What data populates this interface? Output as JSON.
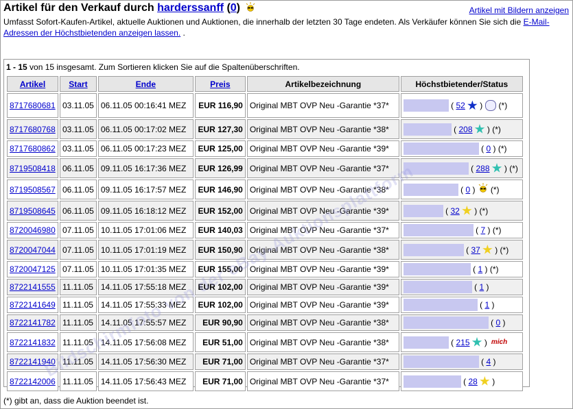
{
  "header": {
    "title_prefix": "Artikel für den Verkauf durch",
    "seller": "harderssanff",
    "feedback_open": "(",
    "feedback_score": "0",
    "feedback_close": ")",
    "new_member_icon": "sunglasses-icon",
    "pictures_link": "Artikel mit Bildern anzeigen"
  },
  "description": {
    "text": "Umfasst Sofort-Kaufen-Artikel, aktuelle Auktionen und Auktionen, die innerhalb der letzten 30 Tage endeten. Als Verkäufer können Sie sich die",
    "link": "E-Mail-Adressen der Höchstbietenden anzeigen lassen.",
    "suffix": "."
  },
  "summary": {
    "range": "1 - 15",
    "text": "von 15 insgesamt. Zum Sortieren klicken Sie auf die Spaltenüberschriften."
  },
  "columns": {
    "artikel": "Artikel",
    "start": "Start",
    "ende": "Ende",
    "preis": "Preis",
    "bezeichnung": "Artikelbezeichnung",
    "status": "Höchstbietender/Status"
  },
  "rows": [
    {
      "id": "8717680681",
      "start": "03.11.05",
      "end": "06.11.05 00:16:41 MEZ",
      "price": "EUR 116,90",
      "title": "Original MBT OVP Neu -Garantie *37*",
      "fb": "52",
      "star": "blue",
      "extra": "people-icon",
      "ended": "(*)"
    },
    {
      "id": "8717680768",
      "start": "03.11.05",
      "end": "06.11.05 00:17:02 MEZ",
      "price": "EUR 127,30",
      "title": "Original MBT OVP Neu -Garantie *38*",
      "fb": "208",
      "star": "turquoise",
      "extra": "",
      "ended": "(*)"
    },
    {
      "id": "8717680862",
      "start": "03.11.05",
      "end": "06.11.05 00:17:23 MEZ",
      "price": "EUR 125,00",
      "title": "Original MBT OVP Neu -Garantie *39*",
      "fb": "0",
      "star": "",
      "extra": "",
      "ended": "(*)"
    },
    {
      "id": "8719508418",
      "start": "06.11.05",
      "end": "09.11.05 16:17:36 MEZ",
      "price": "EUR 126,99",
      "title": "Original MBT OVP Neu -Garantie *37*",
      "fb": "288",
      "star": "turquoise",
      "extra": "",
      "ended": "(*)"
    },
    {
      "id": "8719508567",
      "start": "06.11.05",
      "end": "09.11.05 16:17:57 MEZ",
      "price": "EUR 146,90",
      "title": "Original MBT OVP Neu -Garantie *38*",
      "fb": "0",
      "star": "",
      "extra": "sunglasses-icon",
      "ended": "(*)"
    },
    {
      "id": "8719508645",
      "start": "06.11.05",
      "end": "09.11.05 16:18:12 MEZ",
      "price": "EUR 152,00",
      "title": "Original MBT OVP Neu -Garantie *39*",
      "fb": "32",
      "star": "yellow",
      "extra": "",
      "ended": "(*)"
    },
    {
      "id": "8720046980",
      "start": "07.11.05",
      "end": "10.11.05 17:01:06 MEZ",
      "price": "EUR 140,03",
      "title": "Original MBT OVP Neu -Garantie *37*",
      "fb": "7",
      "star": "",
      "extra": "",
      "ended": "(*)"
    },
    {
      "id": "8720047044",
      "start": "07.11.05",
      "end": "10.11.05 17:01:19 MEZ",
      "price": "EUR 150,90",
      "title": "Original MBT OVP Neu -Garantie *38*",
      "fb": "37",
      "star": "yellow",
      "extra": "",
      "ended": "(*)"
    },
    {
      "id": "8720047125",
      "start": "07.11.05",
      "end": "10.11.05 17:01:35 MEZ",
      "price": "EUR 155,00",
      "title": "Original MBT OVP Neu -Garantie *39*",
      "fb": "1",
      "star": "",
      "extra": "",
      "ended": "(*)"
    },
    {
      "id": "8722141555",
      "start": "11.11.05",
      "end": "14.11.05 17:55:18 MEZ",
      "price": "EUR 102,00",
      "title": "Original MBT OVP Neu -Garantie *39*",
      "fb": "1",
      "star": "",
      "extra": "",
      "ended": ""
    },
    {
      "id": "8722141649",
      "start": "11.11.05",
      "end": "14.11.05 17:55:33 MEZ",
      "price": "EUR 102,00",
      "title": "Original MBT OVP Neu -Garantie *39*",
      "fb": "1",
      "star": "",
      "extra": "",
      "ended": ""
    },
    {
      "id": "8722141782",
      "start": "11.11.05",
      "end": "14.11.05 17:55:57 MEZ",
      "price": "EUR 90,90",
      "title": "Original MBT OVP Neu -Garantie *38*",
      "fb": "0",
      "star": "",
      "extra": "",
      "ended": ""
    },
    {
      "id": "8722141832",
      "start": "11.11.05",
      "end": "14.11.05 17:56:08 MEZ",
      "price": "EUR 51,00",
      "title": "Original MBT OVP Neu -Garantie *38*",
      "fb": "215",
      "star": "turquoise",
      "extra": "me-icon",
      "ended": ""
    },
    {
      "id": "8722141940",
      "start": "11.11.05",
      "end": "14.11.05 17:56:30 MEZ",
      "price": "EUR 71,00",
      "title": "Original MBT OVP Neu -Garantie *37*",
      "fb": "4",
      "star": "",
      "extra": "",
      "ended": ""
    },
    {
      "id": "8722142006",
      "start": "11.11.05",
      "end": "14.11.05 17:56:43 MEZ",
      "price": "EUR 71,00",
      "title": "Original MBT OVP Neu -Garantie *37*",
      "fb": "28",
      "star": "yellow",
      "extra": "",
      "ended": ""
    }
  ],
  "me_label": "mich",
  "footnote": "(*) gibt an, dass die Auktion beendet ist.",
  "watermark": "Bildschirmfoto von der eBay-Auktionsplattform",
  "colors": {
    "link": "#0000cc",
    "header_bg": "#e6e6e6",
    "bar": "#c8c8f0",
    "star_blue": "#1030c8",
    "star_turquoise": "#30c0b0",
    "star_yellow": "#f0d020"
  }
}
